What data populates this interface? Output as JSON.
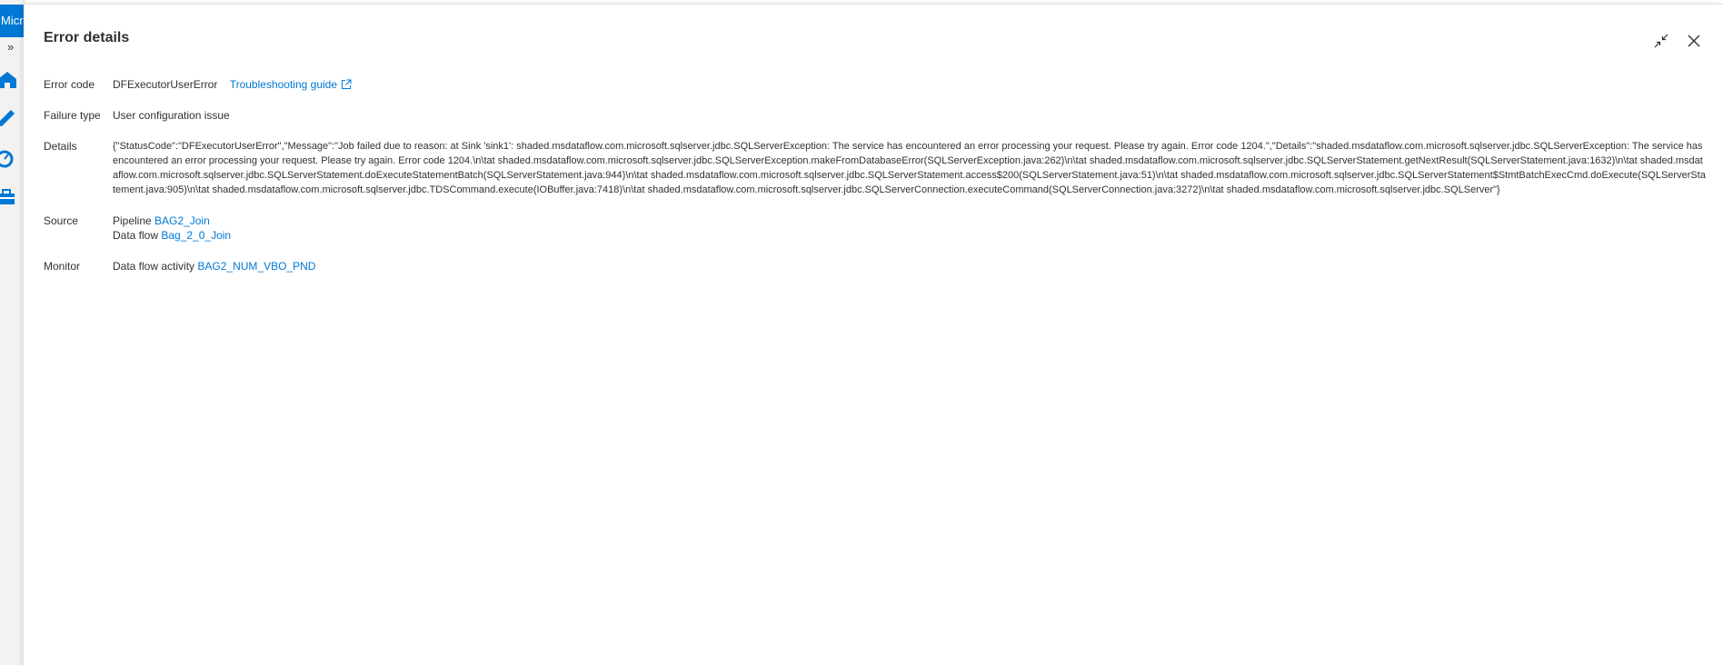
{
  "rail": {
    "brand_text": "Micr",
    "expand_glyph": "»",
    "icons": [
      "home-icon",
      "pencil-icon",
      "monitor-gauge-icon",
      "toolbox-icon"
    ]
  },
  "panel": {
    "title": "Error details",
    "actions": {
      "collapse_icon": "collapse-arrows-icon",
      "close_icon": "close-icon"
    }
  },
  "error": {
    "code_label": "Error code",
    "code_value": "DFExecutorUserError",
    "troubleshooting_link": "Troubleshooting guide",
    "failure_label": "Failure type",
    "failure_value": "User configuration issue",
    "details_label": "Details",
    "details_value": "{\"StatusCode\":\"DFExecutorUserError\",\"Message\":\"Job failed due to reason: at Sink 'sink1': shaded.msdataflow.com.microsoft.sqlserver.jdbc.SQLServerException: The service has encountered an error processing your request. Please try again. Error code 1204.\",\"Details\":\"shaded.msdataflow.com.microsoft.sqlserver.jdbc.SQLServerException: The service has encountered an error processing your request. Please try again. Error code 1204.\\n\\tat shaded.msdataflow.com.microsoft.sqlserver.jdbc.SQLServerException.makeFromDatabaseError(SQLServerException.java:262)\\n\\tat shaded.msdataflow.com.microsoft.sqlserver.jdbc.SQLServerStatement.getNextResult(SQLServerStatement.java:1632)\\n\\tat shaded.msdataflow.com.microsoft.sqlserver.jdbc.SQLServerStatement.doExecuteStatementBatch(SQLServerStatement.java:944)\\n\\tat shaded.msdataflow.com.microsoft.sqlserver.jdbc.SQLServerStatement.access$200(SQLServerStatement.java:51)\\n\\tat shaded.msdataflow.com.microsoft.sqlserver.jdbc.SQLServerStatement$StmtBatchExecCmd.doExecute(SQLServerStatement.java:905)\\n\\tat shaded.msdataflow.com.microsoft.sqlserver.jdbc.TDSCommand.execute(IOBuffer.java:7418)\\n\\tat shaded.msdataflow.com.microsoft.sqlserver.jdbc.SQLServerConnection.executeCommand(SQLServerConnection.java:3272)\\n\\tat shaded.msdataflow.com.microsoft.sqlserver.jdbc.SQLServer\"}",
    "source_label": "Source",
    "pipeline_prefix": "Pipeline",
    "pipeline_link": "BAG2_Join",
    "dataflow_prefix": "Data flow",
    "dataflow_link": "Bag_2_0_Join",
    "monitor_label": "Monitor",
    "activity_prefix": "Data flow activity",
    "activity_link": "BAG2_NUM_VBO_PND"
  },
  "colors": {
    "accent": "#0078d4",
    "text": "#323130",
    "rail_bg": "#f3f2f1"
  }
}
